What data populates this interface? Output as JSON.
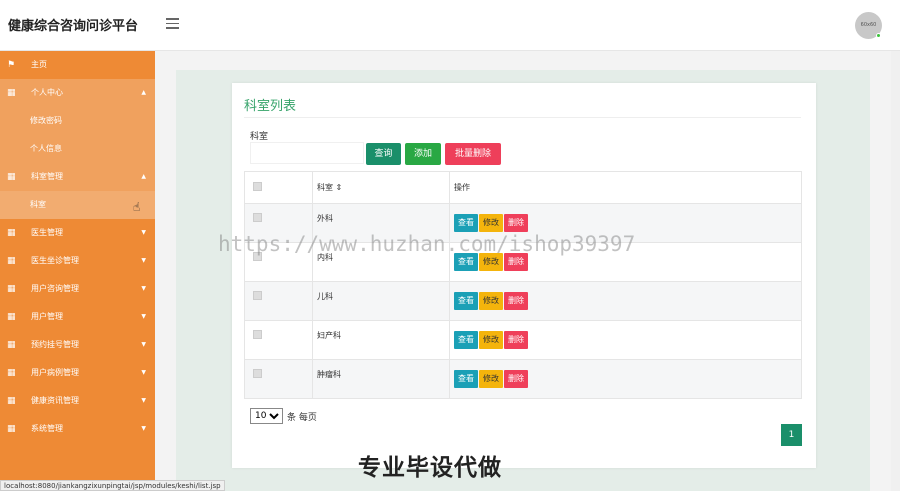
{
  "header": {
    "brand": "健康综合咨询问诊平台",
    "avatar_text": "60x60"
  },
  "sidebar": {
    "items": [
      {
        "key": "home",
        "label": "主页",
        "icon": "flag-icon"
      },
      {
        "key": "personal",
        "label": "个人中心",
        "icon": "grid-icon",
        "open": true,
        "children": [
          {
            "label": "修改密码"
          },
          {
            "label": "个人信息"
          }
        ]
      },
      {
        "key": "dept",
        "label": "科室管理",
        "icon": "grid-icon",
        "open": true,
        "children": [
          {
            "label": "科室",
            "active": true
          }
        ]
      },
      {
        "key": "doctor",
        "label": "医生管理",
        "icon": "grid-icon"
      },
      {
        "key": "doctor-duty",
        "label": "医生坐诊管理",
        "icon": "grid-icon"
      },
      {
        "key": "consult",
        "label": "用户咨询管理",
        "icon": "grid-icon"
      },
      {
        "key": "user",
        "label": "用户管理",
        "icon": "grid-icon"
      },
      {
        "key": "booking",
        "label": "预约挂号管理",
        "icon": "grid-icon"
      },
      {
        "key": "records",
        "label": "用户病例管理",
        "icon": "grid-icon"
      },
      {
        "key": "news",
        "label": "健康资讯管理",
        "icon": "grid-icon"
      },
      {
        "key": "system",
        "label": "系统管理",
        "icon": "grid-icon"
      }
    ]
  },
  "card": {
    "title": "科室列表",
    "search_label": "科室",
    "search_value": "",
    "buttons": {
      "query": "查询",
      "add": "添加",
      "batch_delete": "批量删除"
    },
    "table": {
      "headers": [
        "",
        "科室 ⇕",
        "操作"
      ],
      "rows": [
        "外科",
        "内科",
        "儿科",
        "妇产科",
        "肿瘤科"
      ],
      "actions": {
        "view": "查看",
        "edit": "修改",
        "delete": "删除"
      }
    },
    "pagination": {
      "page_size": "10",
      "page_size_label": "条 每页",
      "current_page": "1"
    }
  },
  "watermark": "https://www.huzhan.com/ishop39397",
  "overlay_text": "专业毕设代做",
  "status_url": "localhost:8080/jiankangzixunpingtai/jsp/modules/keshi/list.jsp",
  "colors": {
    "sidebar": "#ee8a35",
    "accent_green": "#1a8f6a",
    "danger": "#ef3f5a",
    "warning": "#f4b40c",
    "info": "#1ba0b6"
  }
}
